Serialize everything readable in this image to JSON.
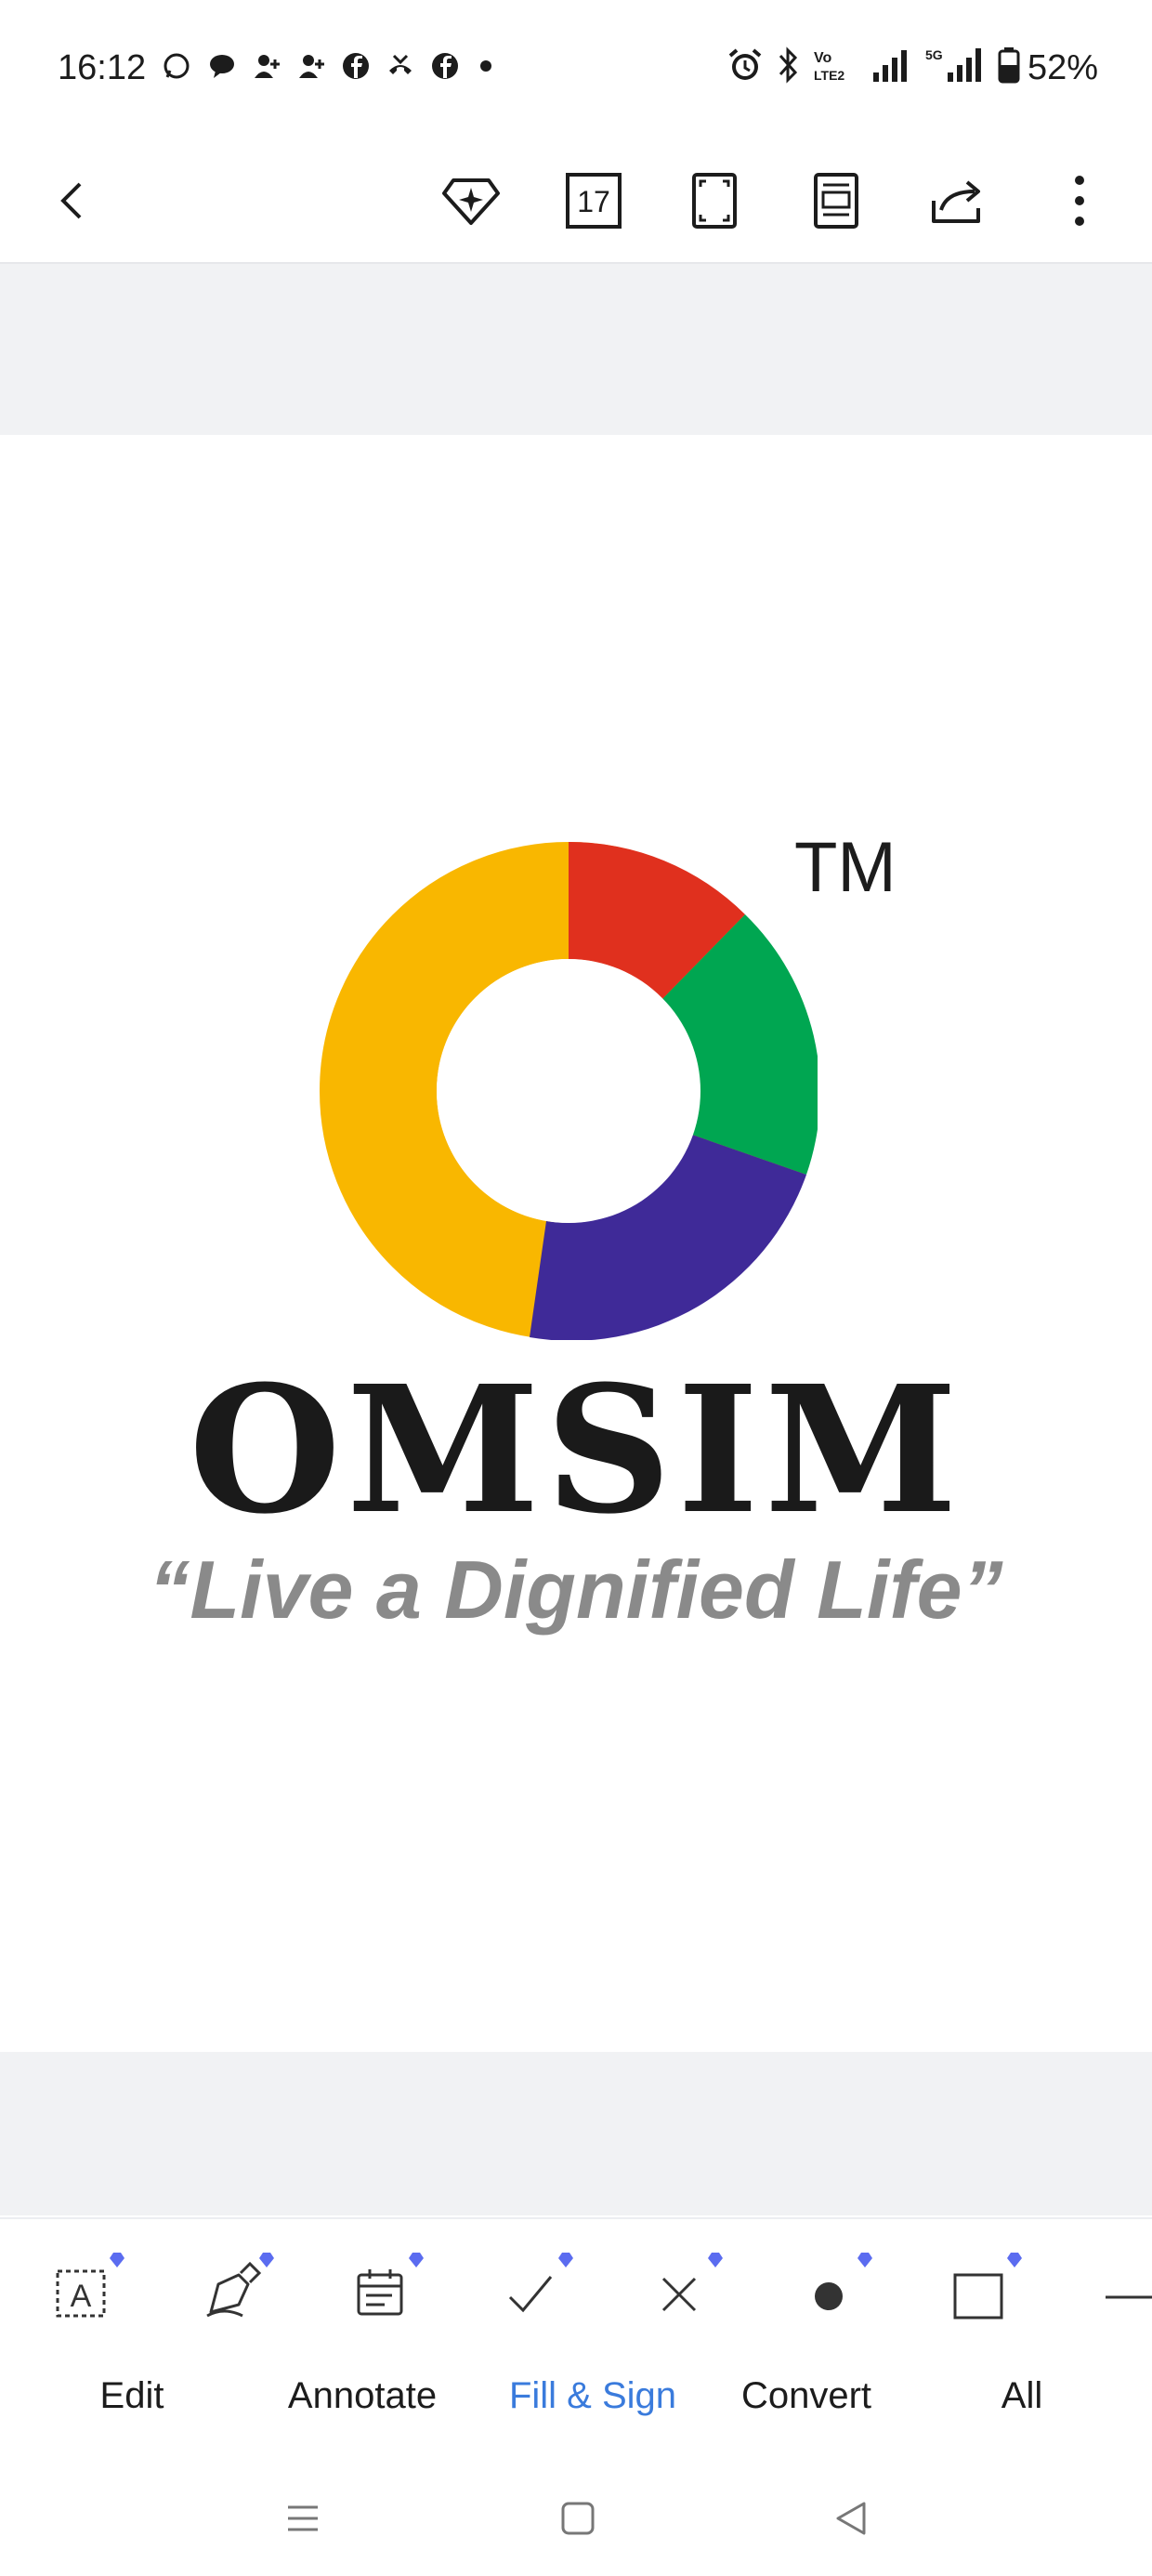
{
  "status_bar": {
    "time": "16:12",
    "battery": "52%"
  },
  "toolbar": {
    "page_count": "17"
  },
  "document": {
    "tm": "TM",
    "brand": "OMSIM",
    "tagline": "“Live a Dignified Life”",
    "logo_colors": {
      "red": "#e0301e",
      "green": "#00a651",
      "purple": "#3f2a98",
      "yellow": "#f9b700"
    }
  },
  "tabs": [
    {
      "label": "Edit"
    },
    {
      "label": "Annotate"
    },
    {
      "label": "Fill & Sign"
    },
    {
      "label": "Convert"
    },
    {
      "label": "All"
    }
  ],
  "colors": {
    "accent": "#3a7bdc",
    "premium": "#5b6cf0"
  }
}
